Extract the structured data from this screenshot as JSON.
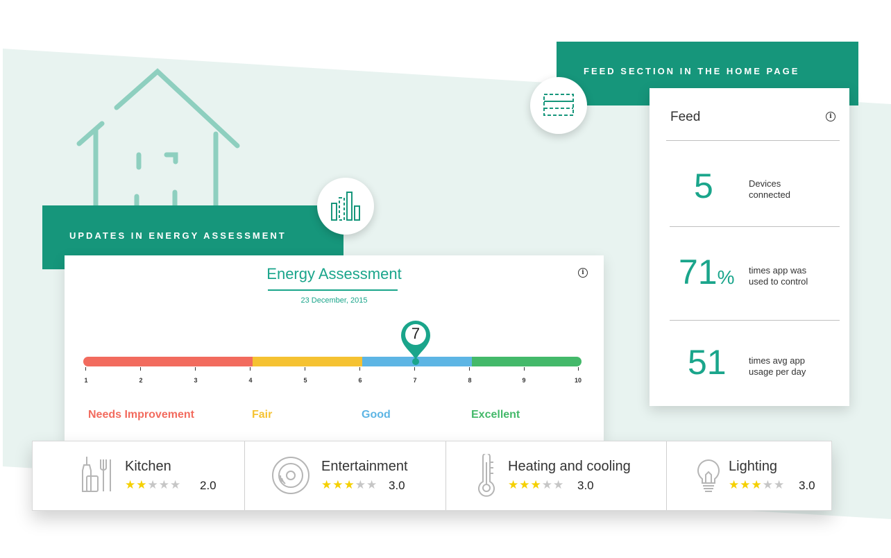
{
  "colors": {
    "brand_green": "#16967b",
    "accent_teal": "#1aa58b",
    "needs_improvement": "#f26b5e",
    "fair": "#f5c232",
    "good": "#5db5e4",
    "excellent": "#44b96a",
    "star_on": "#f5d000",
    "background_band": "#e8f3f0"
  },
  "banners": {
    "energy": "UPDATES IN ENERGY ASSESSMENT",
    "feed": "FEED SECTION IN THE HOME PAGE"
  },
  "energy_assessment": {
    "title": "Energy Assessment",
    "date": "23 December, 2015",
    "score": "7",
    "scale_ticks": [
      "1",
      "2",
      "3",
      "4",
      "5",
      "6",
      "7",
      "8",
      "9",
      "10"
    ],
    "categories": [
      "Needs Improvement",
      "Fair",
      "Good",
      "Excellent"
    ],
    "info_icon": "info-icon"
  },
  "rooms": [
    {
      "name": "Kitchen",
      "icon": "kitchen-icon",
      "stars": 2,
      "rating": "2.0"
    },
    {
      "name": "Entertainment",
      "icon": "disc-icon",
      "stars": 3,
      "rating": "3.0"
    },
    {
      "name": "Heating and cooling",
      "icon": "thermometer-icon",
      "stars": 3,
      "rating": "3.0"
    },
    {
      "name": "Lighting",
      "icon": "lightbulb-icon",
      "stars": 3,
      "rating": "3.0"
    }
  ],
  "feed": {
    "title": "Feed",
    "stats": [
      {
        "value": "5",
        "suffix": "",
        "desc_line1": "Devices",
        "desc_line2": "connected"
      },
      {
        "value": "71",
        "suffix": "%",
        "desc_line1": "times app was",
        "desc_line2": "used to control"
      },
      {
        "value": "51",
        "suffix": "",
        "desc_line1": "times avg app",
        "desc_line2": "usage per day"
      }
    ]
  }
}
